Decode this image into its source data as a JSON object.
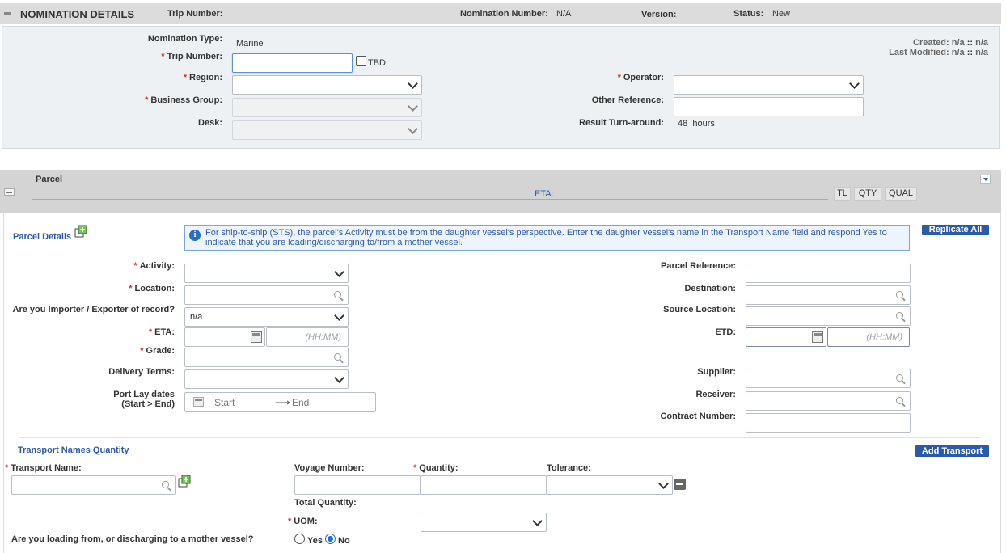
{
  "header": {
    "title": "NOMINATION DETAILS",
    "trip_number_label": "Trip Number:",
    "nomination_number_label": "Nomination Number:",
    "nomination_number_value": "N/A",
    "version_label": "Version:",
    "status_label": "Status:",
    "status_value": "New"
  },
  "nomination": {
    "nomination_type_label": "Nomination Type:",
    "nomination_type_value": "Marine",
    "trip_number_label": "Trip Number:",
    "tbd_label": "TBD",
    "region_label": "Region:",
    "business_group_label": "Business Group:",
    "desk_label": "Desk:",
    "operator_label": "Operator:",
    "other_reference_label": "Other Reference:",
    "result_turnaround_label": "Result Turn-around:",
    "result_turnaround_value": "48",
    "result_turnaround_unit": "hours",
    "created_label": "Created:",
    "created_value": "n/a",
    "created_value2": "n/a",
    "last_modified_label": "Last Modified:",
    "last_modified_value": "n/a",
    "last_modified_value2": "n/a"
  },
  "parcel_bar": {
    "title": "Parcel",
    "eta_label": "ETA:",
    "tl_label": "TL",
    "qty_label": "QTY",
    "qual_label": "QUAL"
  },
  "parcel": {
    "details_label": "Parcel Details",
    "info_text": "For ship-to-ship (STS), the parcel's Activity must be from the daughter vessel's perspective. Enter the daughter vessel's name in the Transport Name field and respond Yes to indicate that you are loading/discharging to/from a mother vessel.",
    "replicate_all_label": "Replicate All",
    "activity_label": "Activity:",
    "location_label": "Location:",
    "importer_label": "Are you Importer / Exporter of record?",
    "importer_value": "n/a",
    "eta_label": "ETA:",
    "time_placeholder": "(HH:MM)",
    "grade_label": "Grade:",
    "delivery_terms_label": "Delivery Terms:",
    "port_lay_label_1": "Port Lay dates",
    "port_lay_label_2": "(Start > End)",
    "start_placeholder": "Start",
    "end_placeholder": "End",
    "parcel_reference_label": "Parcel Reference:",
    "destination_label": "Destination:",
    "source_location_label": "Source Location:",
    "etd_label": "ETD:",
    "supplier_label": "Supplier:",
    "receiver_label": "Receiver:",
    "contract_number_label": "Contract Number:"
  },
  "transport": {
    "section_label": "Transport Names Quantity",
    "add_transport_label": "Add Transport",
    "transport_name_label": "Transport Name:",
    "voyage_number_label": "Voyage Number:",
    "quantity_label": "Quantity:",
    "tolerance_label": "Tolerance:",
    "total_quantity_label": "Total Quantity:",
    "uom_label": "UOM:",
    "mother_vessel_label": "Are you loading from, or discharging to a mother vessel?",
    "yes_label": "Yes",
    "no_label": "No",
    "selected": "No"
  }
}
